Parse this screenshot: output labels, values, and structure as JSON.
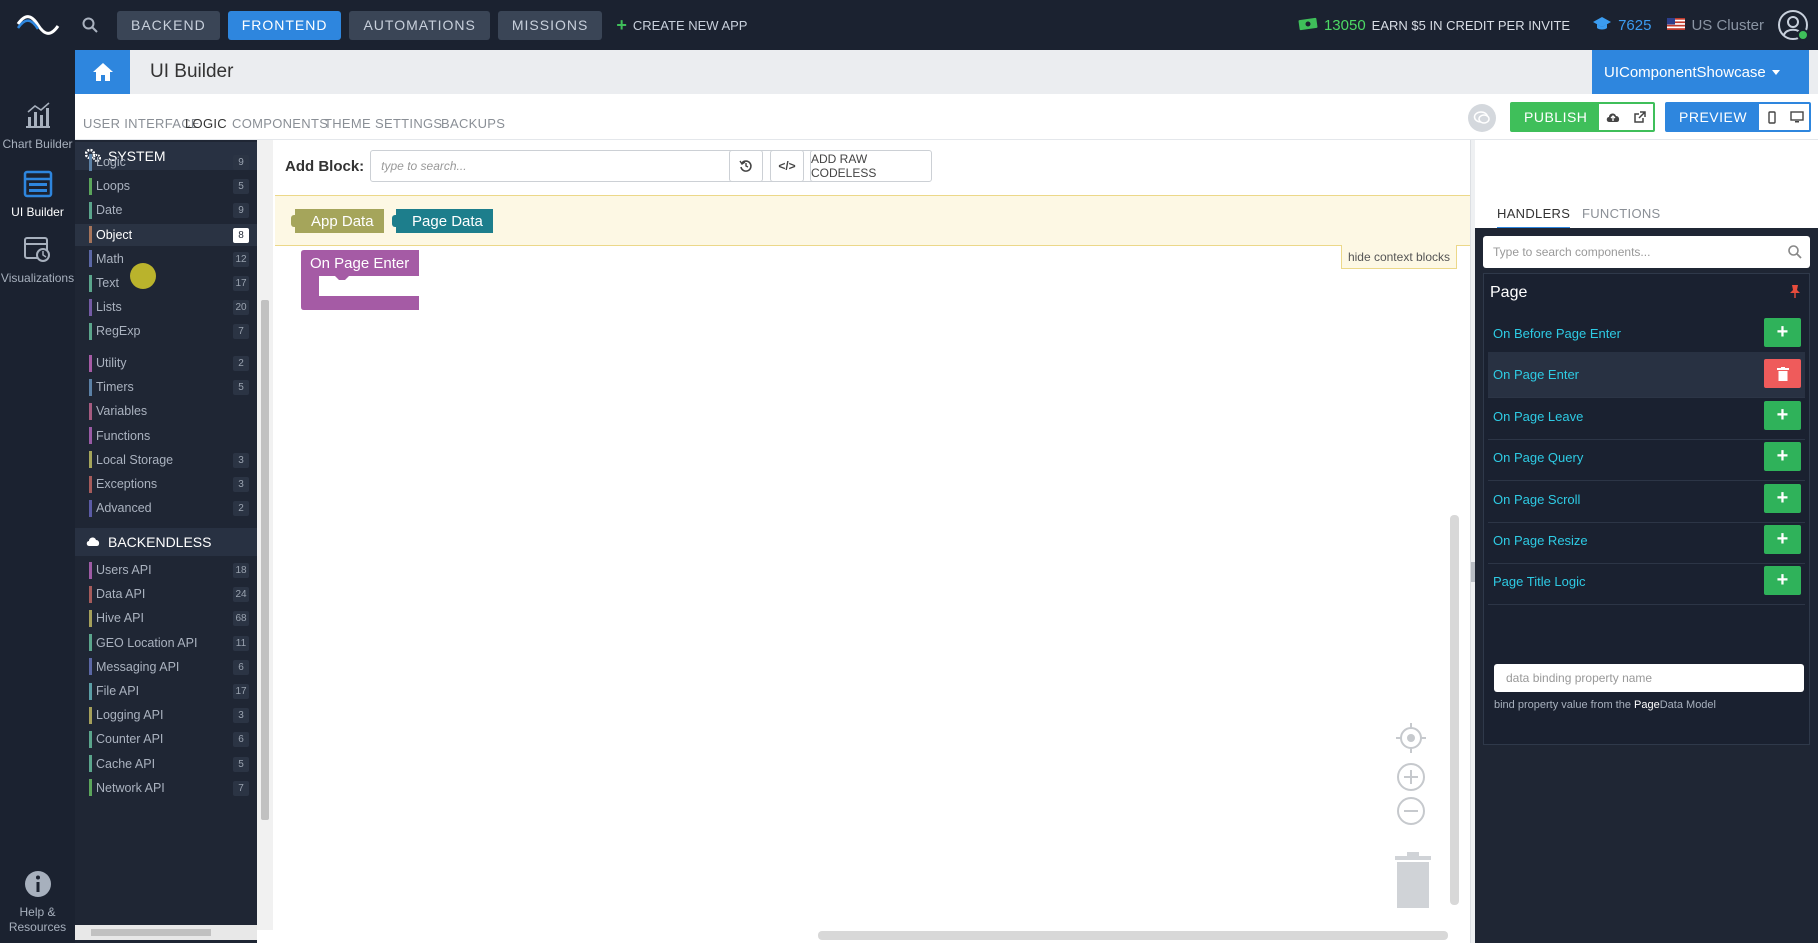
{
  "topbar": {
    "nav": [
      "BACKEND",
      "FRONTEND",
      "AUTOMATIONS",
      "MISSIONS"
    ],
    "create_app": "CREATE NEW APP",
    "credits": "13050",
    "credits_text": "EARN $5 IN CREDIT PER INVITE",
    "missions_points": "7625",
    "cluster": "US Cluster"
  },
  "rail": {
    "items": [
      {
        "label": "Chart Builder",
        "icon": "chart-icon"
      },
      {
        "label": "UI Builder",
        "icon": "ui-builder-icon"
      },
      {
        "label": "Visualizations",
        "icon": "visualizations-icon"
      }
    ],
    "help": "Help & Resources"
  },
  "header": {
    "title": "UI Builder",
    "app_name": "UIComponentShowcase"
  },
  "tabs": [
    "USER INTERFACE",
    "LOGIC",
    "COMPONENTS",
    "THEME",
    "SETTINGS",
    "BACKUPS"
  ],
  "actions": {
    "publish": "PUBLISH",
    "preview": "PREVIEW"
  },
  "categories": {
    "system_title": "SYSTEM",
    "system": [
      {
        "name": "Logic",
        "count": "9",
        "color": "#5b80a5"
      },
      {
        "name": "Loops",
        "count": "5",
        "color": "#5ba55b"
      },
      {
        "name": "Date",
        "count": "9",
        "color": "#5ba58c"
      },
      {
        "name": "Object",
        "count": "8",
        "color": "#a5745b"
      },
      {
        "name": "Math",
        "count": "12",
        "color": "#5b67a5"
      },
      {
        "name": "Text",
        "count": "17",
        "color": "#5ba58c"
      },
      {
        "name": "Lists",
        "count": "20",
        "color": "#745ba5"
      },
      {
        "name": "RegExp",
        "count": "7",
        "color": "#5ba58c"
      }
    ],
    "system2": [
      {
        "name": "Utility",
        "count": "2",
        "color": "#a55ba5"
      },
      {
        "name": "Timers",
        "count": "5",
        "color": "#5b80a5"
      },
      {
        "name": "Variables",
        "count": "",
        "color": "#a55b80"
      },
      {
        "name": "Functions",
        "count": "",
        "color": "#995ba5"
      },
      {
        "name": "Local Storage",
        "count": "3",
        "color": "#a5a55b"
      },
      {
        "name": "Exceptions",
        "count": "3",
        "color": "#a55b5b"
      },
      {
        "name": "Advanced",
        "count": "2",
        "color": "#5b5ba5"
      }
    ],
    "backendless_title": "BACKENDLESS",
    "backendless": [
      {
        "name": "Users API",
        "count": "18",
        "color": "#9e5ba5"
      },
      {
        "name": "Data API",
        "count": "24",
        "color": "#a55b5b"
      },
      {
        "name": "Hive API",
        "count": "68",
        "color": "#a5a05b"
      },
      {
        "name": "GEO Location API",
        "count": "11",
        "color": "#5ba58c"
      },
      {
        "name": "Messaging API",
        "count": "6",
        "color": "#5b67a5"
      },
      {
        "name": "File API",
        "count": "17",
        "color": "#5b9ea5"
      },
      {
        "name": "Logging API",
        "count": "3",
        "color": "#a5a05b"
      },
      {
        "name": "Counter API",
        "count": "6",
        "color": "#5ba58c"
      },
      {
        "name": "Cache API",
        "count": "5",
        "color": "#5ba58c"
      },
      {
        "name": "Network API",
        "count": "7",
        "color": "#5ba55b"
      }
    ]
  },
  "workspace": {
    "add_block_label": "Add Block:",
    "add_block_placeholder": "type to search...",
    "raw_codeless": "ADD RAW CODELESS",
    "context_blocks": [
      {
        "label": "App Data",
        "color": "#a5a55b"
      },
      {
        "label": "Page Data",
        "color": "#1d7e8c"
      }
    ],
    "hide_context": "hide context blocks",
    "event_block": {
      "label": "On Page Enter",
      "color": "#a55ba5"
    }
  },
  "right": {
    "tabs": [
      "HANDLERS",
      "FUNCTIONS"
    ],
    "search_placeholder": "Type to search components...",
    "section_title": "Page",
    "handlers": [
      {
        "name": "On Before Page Enter",
        "state": "add"
      },
      {
        "name": "On Page Enter",
        "state": "delete"
      },
      {
        "name": "On Page Leave",
        "state": "add"
      },
      {
        "name": "On Page Query",
        "state": "add"
      },
      {
        "name": "On Page Scroll",
        "state": "add"
      },
      {
        "name": "On Page Resize",
        "state": "add"
      },
      {
        "name": "Page Title Logic",
        "state": "add"
      }
    ],
    "binding_placeholder": "data binding property name",
    "binding_hint_pre": "bind property value from the ",
    "binding_hint_bold": "Page",
    "binding_hint_post": "Data Model"
  }
}
